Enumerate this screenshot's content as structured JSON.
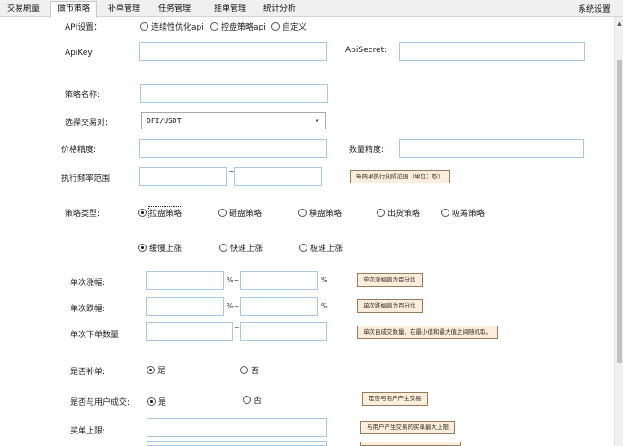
{
  "tabs": [
    {
      "label": "交易刷量"
    },
    {
      "label": "做市策略"
    },
    {
      "label": "补单管理"
    },
    {
      "label": "任务管理"
    },
    {
      "label": "挂单管理"
    },
    {
      "label": "统计分析"
    }
  ],
  "system_settings": "系统设置",
  "form": {
    "api_settings_label": "API设置：",
    "api_options": [
      "连续性优化api",
      "控盘策略api",
      "自定义"
    ],
    "api_key_label": "ApiKey:",
    "api_key_value": "",
    "api_secret_label": "ApiSecret:",
    "api_secret_value": "",
    "strategy_name_label": "策略名称:",
    "strategy_name_value": "",
    "pair_label": "选择交易对:",
    "pair_value": "DFI/USDT",
    "price_precision_label": "价格精度:",
    "price_precision_value": "",
    "qty_precision_label": "数量精度:",
    "qty_precision_value": "",
    "freq_label": "执行频率范围:",
    "freq_sep": "~",
    "freq_note": "每两单执行间隔范围（单位：秒）",
    "strategy_type_label": "策略类型:",
    "strategy_types": [
      "拉盘策略",
      "砸盘策略",
      "横盘策略",
      "出货策略",
      "吸筹策略"
    ],
    "rise_modes": [
      "缓慢上涨",
      "快速上涨",
      "极速上涨"
    ],
    "rise_label": "单次涨幅:",
    "rise_sep": "%~",
    "rise_unit": "%",
    "rise_note": "单次涨幅值为百分比",
    "fall_label": "单次跌幅:",
    "fall_sep": "%~",
    "fall_unit": "%",
    "fall_note": "单次跌幅值为百分比",
    "order_qty_label": "单次下单数量:",
    "order_qty_sep": "~",
    "order_qty_note": "单次自成交数量，在最小值和最大值之间随机取。",
    "fill_order_label": "是否补单:",
    "fill_yes": "是",
    "fill_no": "否",
    "user_trade_label": "是否与用户成交:",
    "user_yes": "是",
    "user_no": "否",
    "user_trade_note": "是否与用户产生交易",
    "buy_limit_label": "买单上限:",
    "buy_limit_note": "与用户产生交易的买单最大上限"
  }
}
